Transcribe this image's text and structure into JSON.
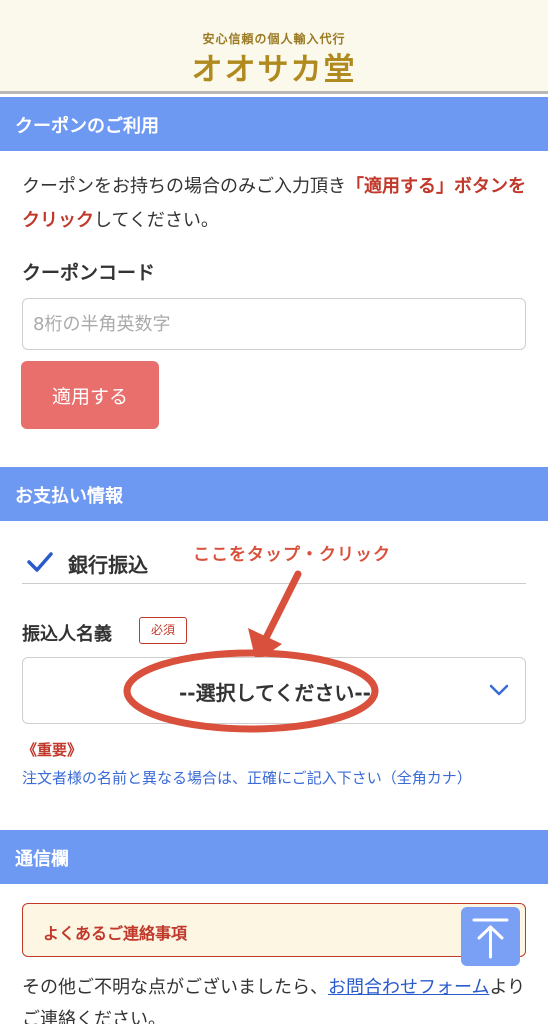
{
  "header": {
    "logo_subtitle": "安心信頼の個人輸入代行",
    "logo_title": "オオサカ堂"
  },
  "coupon": {
    "section_title": "クーポンのご利用",
    "description_before": "クーポンをお持ちの場合のみご入力頂き",
    "description_highlight": "「適用する」ボタンをクリック",
    "description_after": "してください。",
    "code_label": "クーポンコード",
    "code_value": "",
    "code_placeholder": "8桁の半角英数字",
    "apply_button": "適用する"
  },
  "payment": {
    "section_title": "お支払い情報",
    "method": "銀行振込",
    "annotation": "ここをタップ・クリック",
    "payer_name_label": "振込人名義",
    "required_badge": "必須",
    "select_value": "--選択してください--",
    "notice_highlight": "《重要》",
    "notice_text": "注文者様の名前と異なる場合は、正確にご記入下さい（全角カナ）"
  },
  "message": {
    "section_title": "通信欄",
    "faq_box_title": "よくあるご連絡事項",
    "other_text": "その他ご不明な点がございましたら、",
    "inquiry_link": "お問合わせフォーム",
    "other_text_after": "よりご連絡ください。"
  },
  "colors": {
    "section_bar": "#6e99f2",
    "accent_red": "#c0392b",
    "apply_button": "#e86f6c",
    "annotation": "#d9513c",
    "link_blue": "#2a5bcc"
  },
  "icons": {
    "check": "check-icon",
    "chevron": "chevron-down-icon",
    "scroll_top": "arrow-up-icon"
  }
}
